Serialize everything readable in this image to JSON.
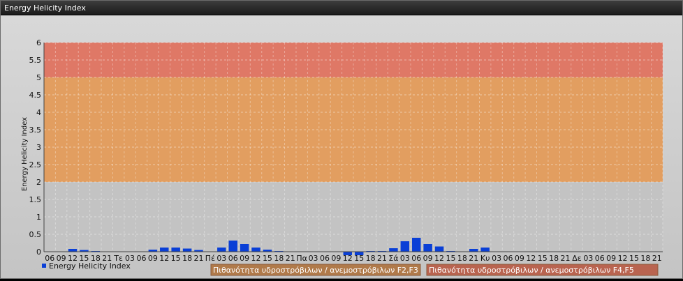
{
  "window": {
    "title": "Energy Helicity Index"
  },
  "chart_data": {
    "type": "bar",
    "title": "",
    "xlabel": "",
    "ylabel": "Energy Helicity Index",
    "ylim": [
      0,
      6
    ],
    "yticks": [
      "0",
      "0.5",
      "1",
      "1.5",
      "2",
      "2.5",
      "3",
      "3.5",
      "4",
      "4.5",
      "5",
      "5.5",
      "6"
    ],
    "grid": true,
    "categories": [
      "06",
      "09",
      "12",
      "15",
      "18",
      "21",
      "Τε",
      "03",
      "06",
      "09",
      "12",
      "15",
      "18",
      "21",
      "Πέ",
      "03",
      "06",
      "09",
      "12",
      "15",
      "18",
      "21",
      "Πα",
      "03",
      "06",
      "09",
      "12",
      "15",
      "18",
      "21",
      "Σά",
      "03",
      "06",
      "09",
      "12",
      "15",
      "18",
      "21",
      "Κυ",
      "03",
      "06",
      "09",
      "12",
      "15",
      "18",
      "21",
      "Δε",
      "03",
      "06",
      "09",
      "12",
      "15",
      "18",
      "21"
    ],
    "series": [
      {
        "name": "Energy Helicity Index",
        "color": "#0a3fd6",
        "values": [
          0.01,
          0.01,
          0.08,
          0.05,
          0.02,
          0.01,
          0.01,
          0.01,
          0.01,
          0.06,
          0.12,
          0.12,
          0.09,
          0.05,
          0.01,
          0.12,
          0.32,
          0.22,
          0.12,
          0.06,
          0.02,
          0.01,
          0.01,
          0.01,
          0.01,
          0.01,
          -0.1,
          -0.1,
          0.02,
          0.02,
          0.1,
          0.3,
          0.4,
          0.22,
          0.15,
          0.02,
          0.01,
          0.08,
          0.12,
          0.01,
          0.01,
          0.01,
          0.01,
          0.01,
          0.01,
          0.01,
          0.01,
          0.01,
          0.01,
          0.01,
          0.01,
          0.01,
          0.01,
          0.01
        ]
      }
    ],
    "bands": [
      {
        "from": 2,
        "to": 5,
        "color": "#e69a55",
        "label": "Πιθανότητα υδροστρόβιλων / ανεμοστρόβιλων F2,F3",
        "label_color": "#b07a4a"
      },
      {
        "from": 5,
        "to": 6,
        "color": "#e2705c",
        "label": "Πιθανότητα υδροστρόβιλων / ανεμοστρόβιλων F4,F5",
        "label_color": "#b96450"
      }
    ],
    "legend": {
      "placement": "bottom-left",
      "entries": [
        "Energy Helicity Index"
      ]
    }
  }
}
